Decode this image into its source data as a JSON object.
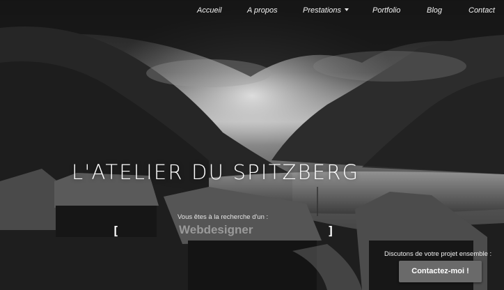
{
  "nav": {
    "items": [
      {
        "label": "Accueil"
      },
      {
        "label": "A propos"
      },
      {
        "label": "Prestations"
      },
      {
        "label": "Portfolio"
      },
      {
        "label": "Blog"
      },
      {
        "label": "Contact"
      }
    ]
  },
  "hero": {
    "title": "L'ATELIER DU SPITZBERG",
    "search_prompt": "Vous êtes à la recherche d'un :",
    "bracket_left": "[",
    "bracket_right": "]",
    "typed_word": "Webdesigner",
    "cta_prompt": "Discutons de votre projet ensemble :",
    "cta_label": "Contactez-moi !"
  },
  "colors": {
    "button_bg": "#6a6a6a",
    "text": "#ffffff",
    "typed_word": "#9a9a9a"
  }
}
